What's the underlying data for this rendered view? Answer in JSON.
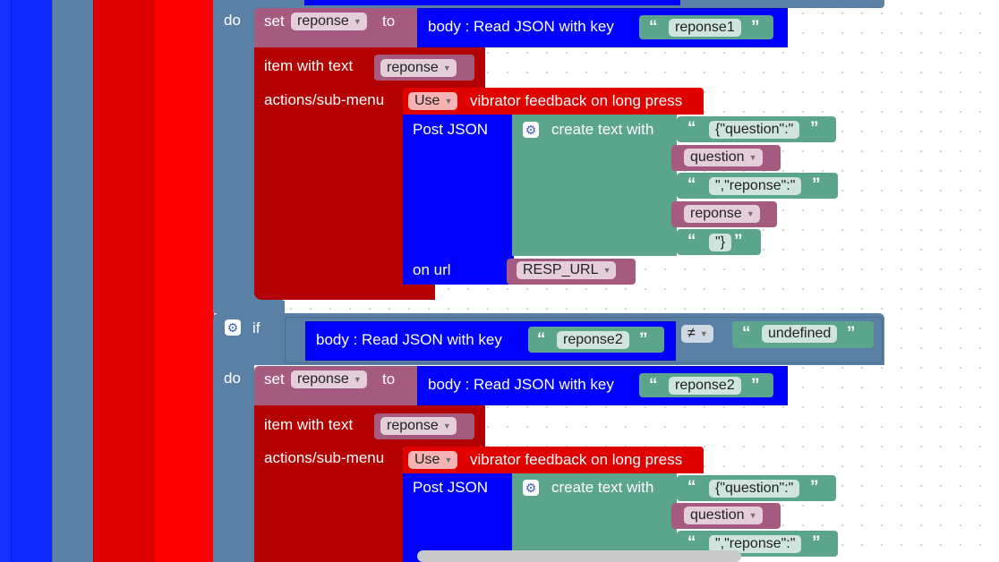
{
  "colors": {
    "loop_blue": "#0d2bff",
    "logic_slate": "#5b80a5",
    "proc_red": "#e00000",
    "bright_red": "#ff0000",
    "variable": "#a55b80",
    "text_green": "#5ba58c",
    "menu_dark_red": "#b30000",
    "web_blue": "#0000ff"
  },
  "blocks": {
    "do_label": "do",
    "if_label": "if",
    "set_label": "set",
    "to_label": "to",
    "variable_name": "reponse",
    "read_json_label": "body : Read JSON with key",
    "key_first": "reponse1",
    "key_second": "reponse2",
    "item_with_text_label": "item with text",
    "actions_label": "actions/sub-menu",
    "use_option": "Use",
    "vibrator_label": "vibrator feedback on long press",
    "post_json_label": "Post JSON",
    "create_text_label": "create text with",
    "text_part_1": "{\"question\":\"",
    "question_var": "question",
    "text_part_2": "\",\"reponse\":\"",
    "text_part_3": "\"}",
    "on_url_label": "on url",
    "url_var": "RESP_URL",
    "compare_op": "≠",
    "undefined_text": "undefined"
  },
  "icons": {
    "dropdown": "▼",
    "quote_open": "“",
    "quote_close": "”",
    "gear": "⚙"
  }
}
